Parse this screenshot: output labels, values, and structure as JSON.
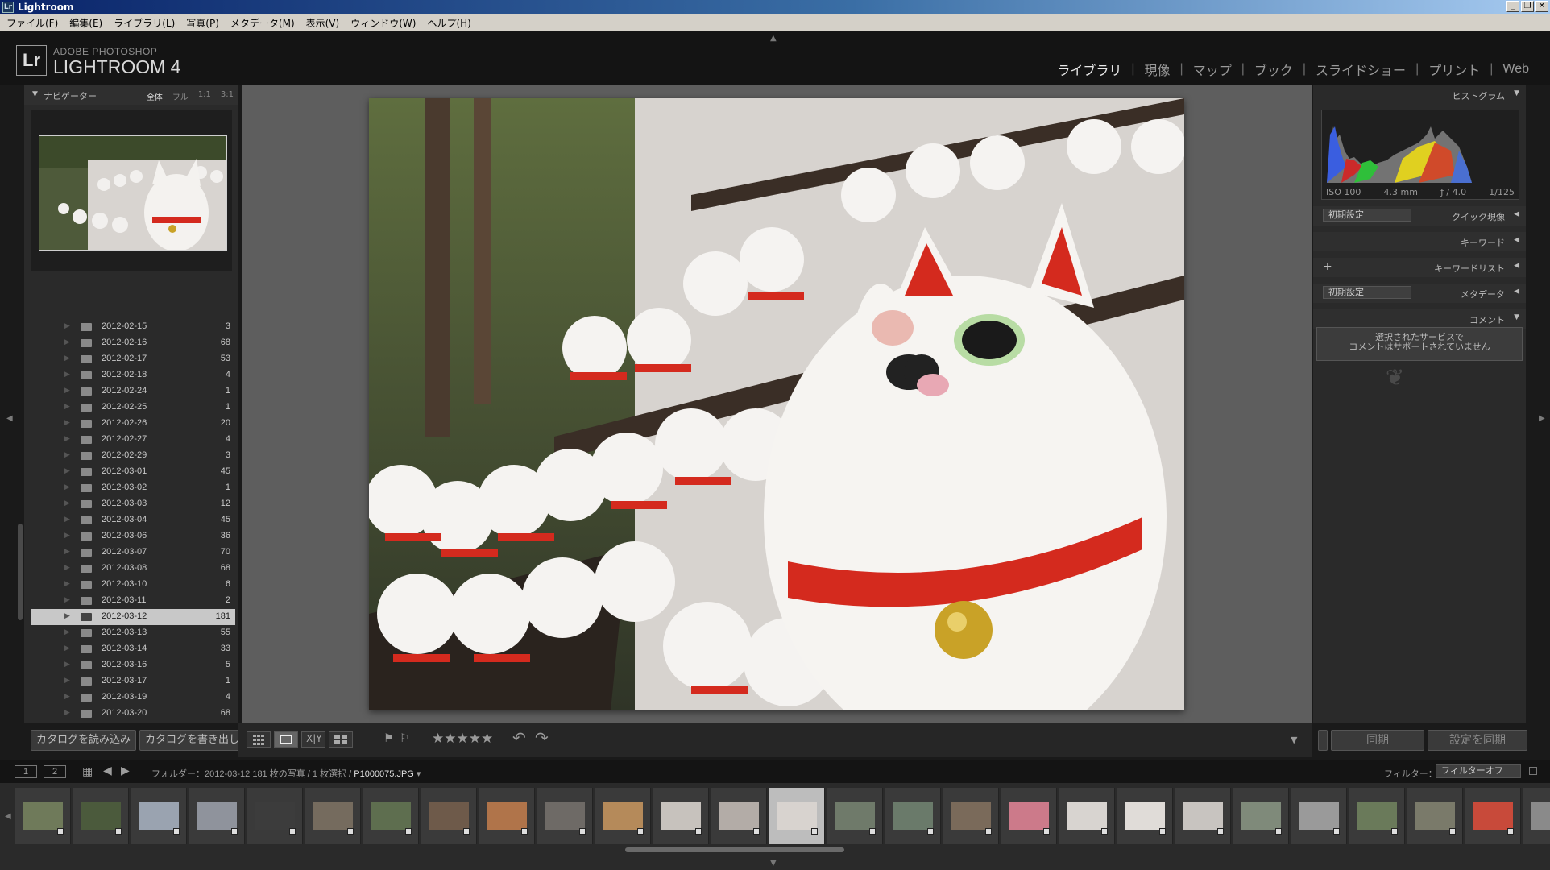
{
  "window": {
    "title": "Lightroom",
    "minimize": "_",
    "restore": "❐",
    "close": "✕"
  },
  "menu": [
    "ファイル(F)",
    "編集(E)",
    "ライブラリ(L)",
    "写真(P)",
    "メタデータ(M)",
    "表示(V)",
    "ウィンドウ(W)",
    "ヘルプ(H)"
  ],
  "brand": {
    "logo": "Lr",
    "small": "ADOBE PHOTOSHOP",
    "big": "LIGHTROOM 4"
  },
  "modules": [
    {
      "label": "ライブラリ",
      "active": true
    },
    {
      "label": "現像",
      "active": false
    },
    {
      "label": "マップ",
      "active": false
    },
    {
      "label": "ブック",
      "active": false
    },
    {
      "label": "スライドショー",
      "active": false
    },
    {
      "label": "プリント",
      "active": false
    },
    {
      "label": "Web",
      "active": false
    }
  ],
  "navigator": {
    "title": "ナビゲーター",
    "zoom_options": [
      "全体",
      "フル",
      "1:1",
      "3:1"
    ]
  },
  "folders": [
    {
      "date": "2012-02-15",
      "count": "3"
    },
    {
      "date": "2012-02-16",
      "count": "68"
    },
    {
      "date": "2012-02-17",
      "count": "53"
    },
    {
      "date": "2012-02-18",
      "count": "4"
    },
    {
      "date": "2012-02-24",
      "count": "1"
    },
    {
      "date": "2012-02-25",
      "count": "1"
    },
    {
      "date": "2012-02-26",
      "count": "20"
    },
    {
      "date": "2012-02-27",
      "count": "4"
    },
    {
      "date": "2012-02-29",
      "count": "3"
    },
    {
      "date": "2012-03-01",
      "count": "45"
    },
    {
      "date": "2012-03-02",
      "count": "1"
    },
    {
      "date": "2012-03-03",
      "count": "12"
    },
    {
      "date": "2012-03-04",
      "count": "45"
    },
    {
      "date": "2012-03-06",
      "count": "36"
    },
    {
      "date": "2012-03-07",
      "count": "70"
    },
    {
      "date": "2012-03-08",
      "count": "68"
    },
    {
      "date": "2012-03-10",
      "count": "6"
    },
    {
      "date": "2012-03-11",
      "count": "2"
    },
    {
      "date": "2012-03-12",
      "count": "181",
      "selected": true
    },
    {
      "date": "2012-03-13",
      "count": "55"
    },
    {
      "date": "2012-03-14",
      "count": "33"
    },
    {
      "date": "2012-03-16",
      "count": "5"
    },
    {
      "date": "2012-03-17",
      "count": "1"
    },
    {
      "date": "2012-03-19",
      "count": "4"
    },
    {
      "date": "2012-03-20",
      "count": "68"
    }
  ],
  "left_buttons": {
    "import_catalog": "カタログを読み込み",
    "export_catalog": "カタログを書き出し"
  },
  "toolbar": {
    "stars": "★★★★★",
    "rotate_left": "↶",
    "rotate_right": "↷",
    "menu_arrow": "▼"
  },
  "right_panel": {
    "histogram_title": "ヒストグラム",
    "histogram_info": [
      "ISO 100",
      "4.3 mm",
      "ƒ / 4.0",
      "1/125"
    ],
    "quick_develop": {
      "preset": "初期設定",
      "label": "クイック現像"
    },
    "keywords": "キーワード",
    "keyword_list": "キーワードリスト",
    "metadata": {
      "preset": "初期設定",
      "label": "メタデータ"
    },
    "comments": "コメント",
    "comment_msg1": "選択されたサービスで",
    "comment_msg2": "コメントはサポートされていません",
    "sync_button": "同期",
    "sync_settings_button": "設定を同期"
  },
  "filmstrip_bar": {
    "monitor1": "1",
    "monitor2": "2",
    "path": "フォルダー：2012-03-12  181 枚の写真 / 1 枚選択 / ",
    "filename": "P1000075.JPG",
    "filter_label": "フィルター：",
    "filter_value": "フィルターオフ"
  },
  "colors": {
    "accent": "#c8c8c8",
    "panel": "#2a2a2a",
    "photo_red": "#d42a1e"
  }
}
